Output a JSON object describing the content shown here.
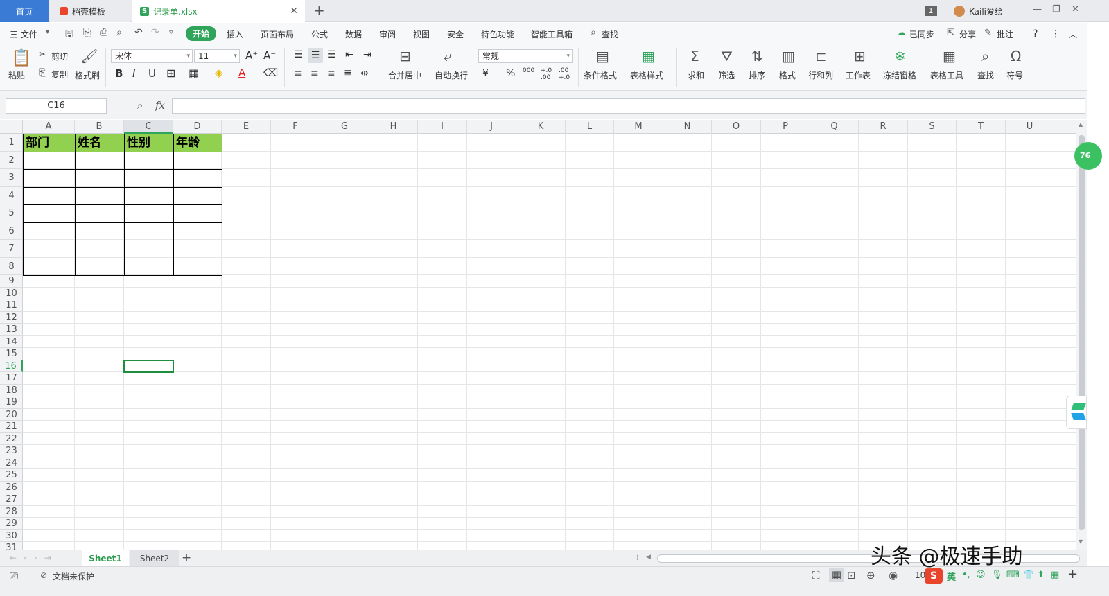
{
  "tabs": {
    "home": "首页",
    "template": "稻壳模板",
    "document": "记录单.xlsx",
    "new_tab": "+",
    "close": "✕",
    "window_count": "1",
    "user": "Kaili爱绘"
  },
  "menu": {
    "file": "三 文件",
    "items": [
      "开始",
      "插入",
      "页面布局",
      "公式",
      "数据",
      "审阅",
      "视图",
      "安全",
      "特色功能",
      "智能工具箱"
    ],
    "search": "查找",
    "sync": "已同步",
    "share": "分享",
    "comment": "批注",
    "help": "?"
  },
  "ribbon": {
    "paste": "粘贴",
    "cut": "剪切",
    "copy": "复制",
    "format_painter": "格式刷",
    "font_name": "宋体",
    "font_size": "11",
    "bold": "B",
    "italic": "I",
    "underline": "U",
    "merge": "合并居中",
    "wrap": "自动换行",
    "number_format": "常规",
    "percent": "%",
    "thousands": "000",
    "inc_decimal": "+.0 .00",
    "dec_decimal": ".00 +.0",
    "cond_format": "条件格式",
    "table_style": "表格样式",
    "sum": "求和",
    "filter": "筛选",
    "sort": "排序",
    "format": "格式",
    "rowcol": "行和列",
    "worksheet": "工作表",
    "freeze": "冻结窗格",
    "table_tools": "表格工具",
    "find": "查找",
    "symbol": "符号"
  },
  "formula_bar": {
    "name_box": "C16",
    "fx": "fx",
    "content": ""
  },
  "sheet": {
    "columns": [
      "A",
      "B",
      "C",
      "D",
      "E",
      "F",
      "G",
      "H",
      "I",
      "J",
      "K",
      "L",
      "M",
      "N",
      "O",
      "P",
      "Q",
      "R",
      "S",
      "T",
      "U"
    ],
    "rows": [
      "1",
      "2",
      "3",
      "4",
      "5",
      "6",
      "7",
      "8",
      "9",
      "10",
      "11",
      "12",
      "13",
      "14",
      "15",
      "16",
      "17",
      "18",
      "19",
      "20",
      "21",
      "22",
      "23",
      "24",
      "25",
      "26",
      "27",
      "28",
      "29",
      "30",
      "31"
    ],
    "header_cells": [
      "部门",
      "姓名",
      "性别",
      "年龄"
    ],
    "active_cell": "C16",
    "header_fill": "#92d050"
  },
  "sheet_tabs": [
    "Sheet1",
    "Sheet2"
  ],
  "add_sheet": "+",
  "status": {
    "protect": "文档未保护",
    "zoom": "10",
    "ime": "英"
  },
  "watermark": "头条 @极速手助",
  "badge": "76"
}
